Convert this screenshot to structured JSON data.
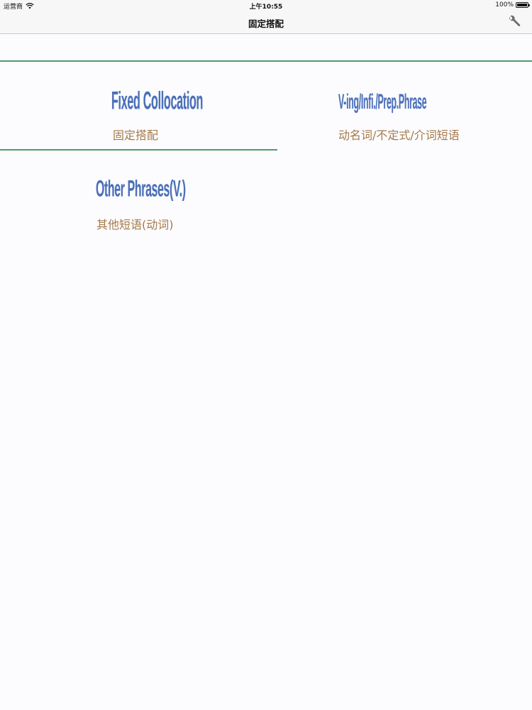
{
  "status_bar": {
    "carrier": "运营商",
    "time": "上午10:55",
    "battery": "100%",
    "battery_level": 1.0
  },
  "nav": {
    "title": "固定搭配",
    "settings_icon": "wrench-icon"
  },
  "colors": {
    "title_blue": "#4a6fb9",
    "subtitle_brown": "#a57948",
    "divider_green": "#4f9a6e",
    "background": "#fcfcfe"
  },
  "categories": [
    {
      "title": "Fixed Collocation",
      "subtitle": "固定搭配"
    },
    {
      "title": "V-ing/Infi./Prep.Phrase",
      "subtitle": "动名词/不定式/介词短语"
    },
    {
      "title": "Other Phrases(V.)",
      "subtitle": "其他短语(动词)"
    }
  ]
}
